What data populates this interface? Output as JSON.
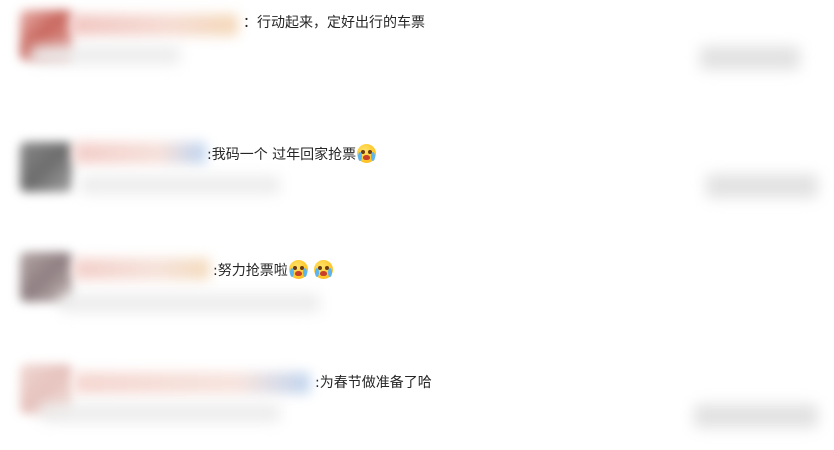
{
  "comments": [
    {
      "text": "：行动起来，定好出行的车票",
      "emojis": []
    },
    {
      "text": ":我码一个 过年回家抢票",
      "emojis": [
        "crying-face-emoji"
      ]
    },
    {
      "text": ":努力抢票啦",
      "emojis": [
        "crying-face-emoji",
        "crying-face-emoji"
      ]
    },
    {
      "text": ":为春节做准备了哈",
      "emojis": []
    }
  ]
}
